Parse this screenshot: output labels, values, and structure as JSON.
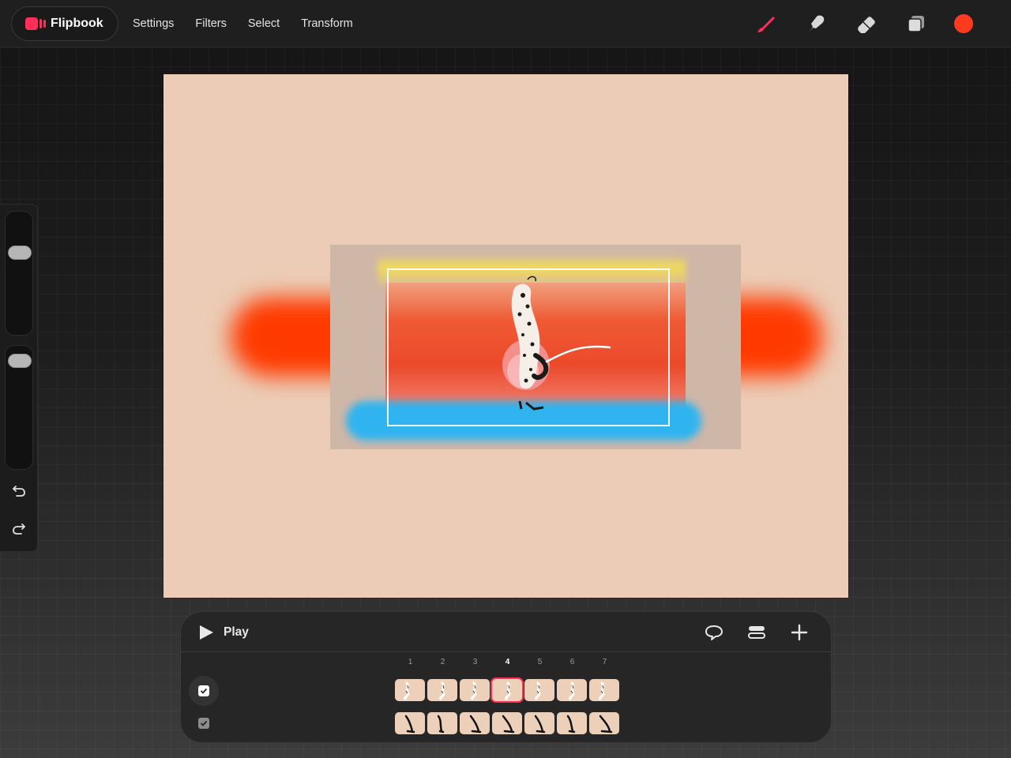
{
  "app": {
    "name": "Flipbook"
  },
  "menu": [
    "Settings",
    "Filters",
    "Select",
    "Transform"
  ],
  "toolbar": {
    "tools": [
      "brush-icon",
      "smudge-icon",
      "eraser-icon",
      "layers-icon"
    ],
    "active_tool": "brush-icon",
    "current_color": "#ff3b1f",
    "accent_color": "#ff2f5a"
  },
  "sidebar": {
    "brush_size_level": 0.7,
    "opacity_level": 0.95,
    "buttons": [
      "undo-icon",
      "redo-icon"
    ]
  },
  "timeline": {
    "play_label": "Play",
    "actions": [
      "loop-icon",
      "layers-stack-icon",
      "add-icon"
    ],
    "frames": [
      "1",
      "2",
      "3",
      "4",
      "5",
      "6",
      "7"
    ],
    "active_frame": "4",
    "tracks": [
      {
        "visible": true,
        "selected": true
      },
      {
        "visible": true,
        "selected": false
      }
    ]
  }
}
